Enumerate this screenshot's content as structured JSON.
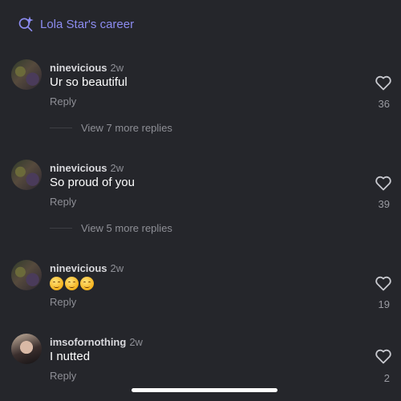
{
  "search": {
    "label": "Lola Star's career",
    "icon": "search-sparkle-icon",
    "color": "#8c8cf0"
  },
  "comments": [
    {
      "username": "ninevicious",
      "time": "2w",
      "text": "Ur so beautiful",
      "reply": "Reply",
      "likes": "36",
      "more": "View 7 more replies"
    },
    {
      "username": "ninevicious",
      "time": "2w",
      "text": "So proud of you",
      "reply": "Reply",
      "likes": "39",
      "more": "View 5 more replies"
    },
    {
      "username": "ninevicious",
      "time": "2w",
      "emojis": [
        "smiling-face-emoji",
        "smiling-face-emoji",
        "smiling-face-emoji"
      ],
      "reply": "Reply",
      "likes": "19"
    },
    {
      "username": "imsofornothing",
      "time": "2w",
      "text": "I nutted",
      "reply": "Reply",
      "likes": "2"
    }
  ]
}
